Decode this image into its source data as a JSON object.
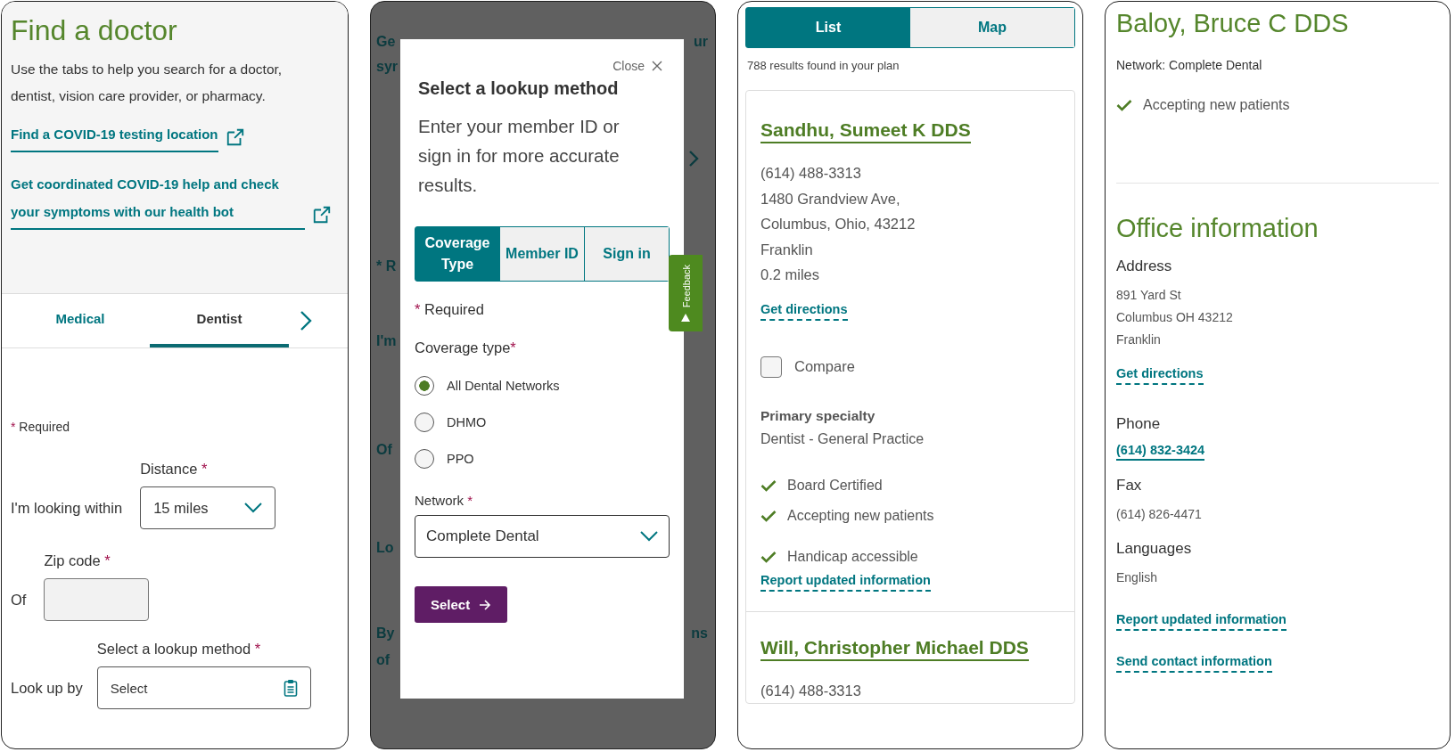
{
  "find_a_doctor": {
    "title": "Find a doctor",
    "intro": "Use the tabs to help you search for a doctor, dentist, vision care provider, or pharmacy.",
    "links": [
      {
        "text": "Find a COVID-19 testing location",
        "external": true
      },
      {
        "text": "Get coordinated COVID-19 help and check your symptoms with our health bot",
        "external": true
      }
    ],
    "tabs": [
      {
        "label": "Medical",
        "selected": false
      },
      {
        "label": "Dentist",
        "selected": true
      }
    ],
    "required_note": {
      "mark": "*",
      "text": "Required"
    },
    "fields": [
      {
        "kind": "select",
        "label": "Distance",
        "mark": "*",
        "prefix": "I'm looking within",
        "value": "15 miles"
      },
      {
        "kind": "input",
        "label": "Zip code",
        "mark": "*",
        "prefix": "Of"
      },
      {
        "kind": "lookup",
        "label": "Select a lookup method",
        "mark": "*",
        "prefix": "Look up by",
        "value": "Select"
      }
    ]
  },
  "lookup_modal": {
    "backdrop_left": [
      "Ge",
      "syr",
      "* R",
      "I'm",
      "Of",
      "Lo",
      "By",
      "of"
    ],
    "backdrop_right": [
      "ur",
      "ns"
    ],
    "close_label": "Close",
    "title": "Select a lookup method",
    "description": "Enter your member ID or sign in for more accurate results.",
    "method_tabs": [
      {
        "label": "Coverage Type",
        "selected": true
      },
      {
        "label": "Member ID",
        "selected": false
      },
      {
        "label": "Sign in",
        "selected": false
      }
    ],
    "required_note": {
      "mark": "*",
      "text": "Required"
    },
    "coverage_type": {
      "label": "Coverage type",
      "mark": "*",
      "options": [
        {
          "label": "All Dental Networks",
          "selected": true
        },
        {
          "label": "DHMO",
          "selected": false
        },
        {
          "label": "PPO",
          "selected": false
        }
      ]
    },
    "network": {
      "label": "Network",
      "mark": "*",
      "value": "Complete Dental"
    },
    "submit": "Select",
    "feedback_tab": "Feedback"
  },
  "results": {
    "view_toggle": [
      {
        "label": "List",
        "selected": true
      },
      {
        "label": "Map",
        "selected": false
      }
    ],
    "count": "788 results found in your plan",
    "providers": [
      {
        "name": "Sandhu, Sumeet K DDS",
        "lines": [
          "(614) 488-3313",
          "1480 Grandview Ave,",
          "Columbus, Ohio, 43212",
          "Franklin",
          "0.2 miles"
        ],
        "directions_link": "Get directions",
        "compare": {
          "label": "Compare",
          "checked": false
        },
        "specialty_label": "Primary specialty",
        "specialty": "Dentist - General Practice",
        "features": [
          "Board Certified",
          "Accepting new patients",
          "Handicap accessible"
        ],
        "report_link": "Report updated information"
      },
      {
        "name": "Will, Christopher Michael DDS",
        "lines": [
          "(614) 488-3313"
        ]
      }
    ]
  },
  "provider_detail": {
    "name": "Baloy, Bruce C DDS",
    "network": "Network: Complete Dental",
    "features": [
      "Accepting new patients"
    ],
    "office_title": "Office information",
    "address_label": "Address",
    "address_lines": [
      "891 Yard St",
      "Columbus OH 43212",
      "Franklin"
    ],
    "directions_link": "Get directions",
    "phone_label": "Phone",
    "phone": "(614) 832-3424",
    "fax_label": "Fax",
    "fax": "(614) 826-4471",
    "languages_label": "Languages",
    "languages": "English",
    "links": [
      "Report updated information",
      "Send contact information"
    ]
  }
}
